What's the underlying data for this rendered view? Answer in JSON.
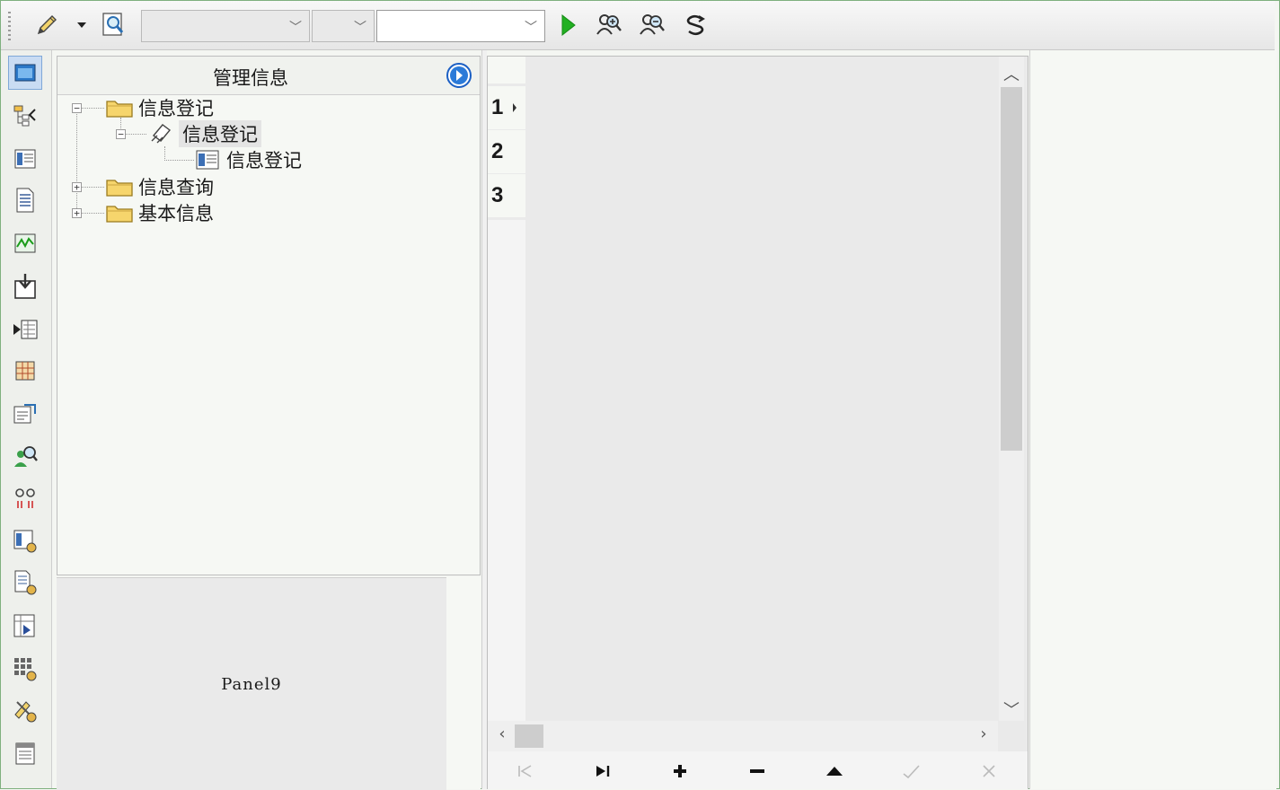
{
  "toolbar": {
    "combo1_value": "",
    "combo2_value": "",
    "combo3_value": "",
    "icons": [
      "pencil-icon",
      "dropdown-arrow-icon",
      "preview-icon",
      "run-icon",
      "zoom-in-user-icon",
      "zoom-out-user-icon",
      "refresh-link-icon"
    ]
  },
  "sidebar": {
    "icons": [
      "form-icon",
      "tree-icon",
      "list-form-icon",
      "document-icon",
      "chart-icon",
      "download-icon",
      "import-icon",
      "grid-icon",
      "report-icon",
      "user-search-icon",
      "link-icon",
      "list-settings-icon",
      "document-settings-icon",
      "export-icon",
      "grid-settings-icon",
      "tools-settings-icon",
      "memo-icon"
    ]
  },
  "tree_panel": {
    "title": "管理信息",
    "items": [
      {
        "label": "信息登记",
        "type": "folder",
        "expanded": true
      },
      {
        "label": "信息登记",
        "type": "module",
        "expanded": true
      },
      {
        "label": "信息登记",
        "type": "form"
      },
      {
        "label": "信息查询",
        "type": "folder",
        "expanded": false
      },
      {
        "label": "基本信息",
        "type": "folder",
        "expanded": false
      }
    ]
  },
  "panel9": {
    "label": "Panel9"
  },
  "grid": {
    "rows": [
      "1",
      "2",
      "3"
    ]
  },
  "navigator": {
    "buttons": [
      "first",
      "last",
      "insert",
      "delete",
      "edit",
      "post",
      "cancel"
    ]
  },
  "colors": {
    "border_green": "#7fb07f",
    "run_green": "#22b022",
    "nav_blue": "#1b5fc4"
  }
}
